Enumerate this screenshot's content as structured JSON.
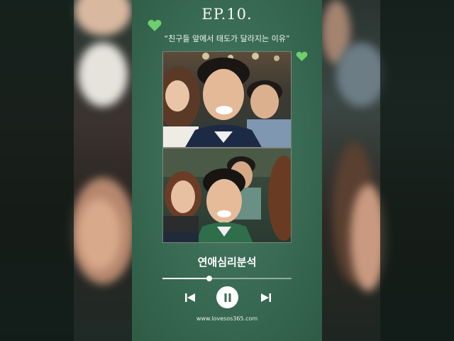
{
  "episode": "EP.10.",
  "subtitle": "“친구들 앞에서 태도가 달라지는 이유”",
  "track_title": "연애심리분석",
  "website": "www.lovesos365.com",
  "player": {
    "progress": 0.36,
    "state": "playing",
    "controls": [
      "skip-previous-icon",
      "pause-icon",
      "skip-next-icon"
    ]
  },
  "colors": {
    "card_green": "#3b6d56",
    "heart_green": "#6fcf6a",
    "text": "#ffffff"
  }
}
